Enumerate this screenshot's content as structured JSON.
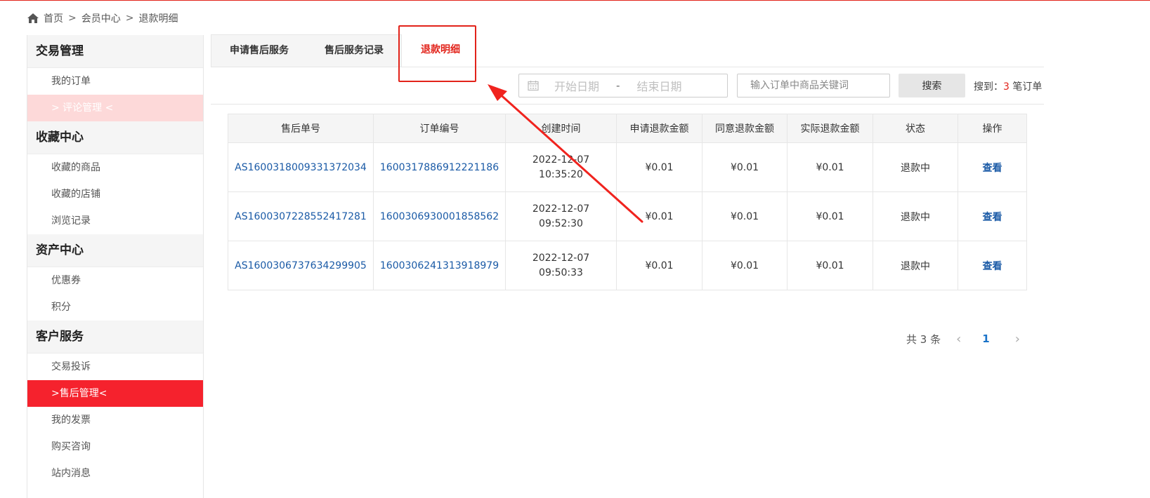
{
  "breadcrumb": {
    "home": "首页",
    "sep": ">",
    "member": "会员中心",
    "current": "退款明细"
  },
  "sidebar": {
    "groups": [
      {
        "title": "交易管理",
        "items": [
          {
            "label": "我的订单"
          },
          {
            "label": "> 评论管理 <"
          }
        ]
      },
      {
        "title": "收藏中心",
        "items": [
          {
            "label": "收藏的商品"
          },
          {
            "label": "收藏的店铺"
          },
          {
            "label": "浏览记录"
          }
        ]
      },
      {
        "title": "资产中心",
        "items": [
          {
            "label": "优惠券"
          },
          {
            "label": "积分"
          }
        ]
      },
      {
        "title": "客户服务",
        "items": [
          {
            "label": "交易投诉"
          },
          {
            "label": ">售后管理<"
          },
          {
            "label": "我的发票"
          },
          {
            "label": "购买咨询"
          },
          {
            "label": "站内消息"
          }
        ]
      }
    ]
  },
  "tabs": [
    {
      "label": "申请售后服务"
    },
    {
      "label": "售后服务记录"
    },
    {
      "label": "退款明细"
    }
  ],
  "filter": {
    "start_placeholder": "开始日期",
    "dash": "-",
    "end_placeholder": "结束日期",
    "keyword_placeholder": "输入订单中商品关键词",
    "search_label": "搜索",
    "found_prefix": "搜到：",
    "found_count": "3",
    "found_suffix": "笔订单"
  },
  "table": {
    "headers": [
      "售后单号",
      "订单编号",
      "创建时间",
      "申请退款金额",
      "同意退款金额",
      "实际退款金额",
      "状态",
      "操作"
    ],
    "rows": [
      {
        "as_no": "AS1600318009331372034",
        "order_no": "1600317886912221186",
        "date": "2022-12-07",
        "time": "10:35:20",
        "apply": "¥0.01",
        "agree": "¥0.01",
        "actual": "¥0.01",
        "status": "退款中",
        "action": "查看"
      },
      {
        "as_no": "AS1600307228552417281",
        "order_no": "1600306930001858562",
        "date": "2022-12-07",
        "time": "09:52:30",
        "apply": "¥0.01",
        "agree": "¥0.01",
        "actual": "¥0.01",
        "status": "退款中",
        "action": "查看"
      },
      {
        "as_no": "AS1600306737634299905",
        "order_no": "1600306241313918979",
        "date": "2022-12-07",
        "time": "09:50:33",
        "apply": "¥0.01",
        "agree": "¥0.01",
        "actual": "¥0.01",
        "status": "退款中",
        "action": "查看"
      }
    ]
  },
  "pager": {
    "total": "共 3 条",
    "prev": "‹",
    "current": "1",
    "next": "›"
  },
  "colors": {
    "accent": "#e2231a",
    "link": "#1a5aa6",
    "active_bg": "#f5222d",
    "soft_bg": "#fdd9d9"
  }
}
